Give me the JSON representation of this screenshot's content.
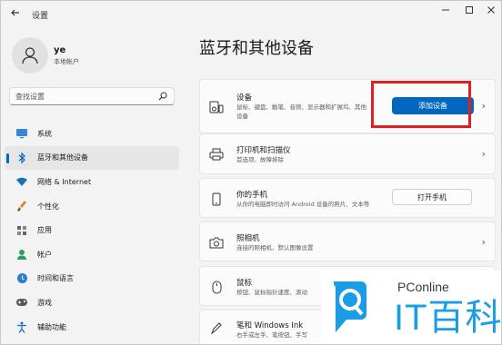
{
  "window": {
    "title": "设置",
    "back_icon": "arrow-left-icon",
    "controls": [
      "minimize-icon",
      "maximize-icon",
      "close-icon"
    ]
  },
  "user": {
    "name": "ye",
    "account": "本地帐户"
  },
  "search": {
    "placeholder": "查找设置"
  },
  "sidebar": {
    "items": [
      {
        "label": "系统",
        "icon": "monitor-icon",
        "active": false
      },
      {
        "label": "蓝牙和其他设备",
        "icon": "bluetooth-icon",
        "active": true
      },
      {
        "label": "网络 & Internet",
        "icon": "wifi-icon",
        "active": false
      },
      {
        "label": "个性化",
        "icon": "brush-icon",
        "active": false
      },
      {
        "label": "应用",
        "icon": "apps-icon",
        "active": false
      },
      {
        "label": "帐户",
        "icon": "person-icon",
        "active": false
      },
      {
        "label": "时间和语言",
        "icon": "globe-clock-icon",
        "active": false
      },
      {
        "label": "游戏",
        "icon": "gamepad-icon",
        "active": false
      },
      {
        "label": "辅助功能",
        "icon": "accessibility-icon",
        "active": false
      }
    ]
  },
  "main": {
    "title": "蓝牙和其他设备",
    "cards": [
      {
        "title": "设备",
        "subtitle": "鼠标、键盘、触笔、音频、显示器和扩展坞、其他设备",
        "icon": "devices-icon",
        "button": "添加设备"
      },
      {
        "title": "打印机和扫描仪",
        "subtitle": "首选项、故障排除",
        "icon": "printer-icon"
      },
      {
        "title": "你的手机",
        "subtitle": "从你的电脑即时访问 Android 设备的照片、文本等",
        "icon": "phone-icon",
        "button": "打开手机"
      },
      {
        "title": "照相机",
        "subtitle": "连接的照相机、默认图像设置",
        "icon": "camera-icon"
      },
      {
        "title": "鼠标",
        "subtitle": "按钮、鼠标指针速度、滚动",
        "icon": "mouse-icon"
      },
      {
        "title": "笔和 Windows Ink",
        "subtitle": "右手或左手、笔按钮、手写",
        "icon": "pen-icon"
      }
    ]
  },
  "watermark": {
    "top_text": "PConline",
    "brand": "IT百科"
  },
  "colors": {
    "accent": "#0067c0",
    "highlight": "#e01f1f",
    "watermark": "#1a9de6"
  }
}
